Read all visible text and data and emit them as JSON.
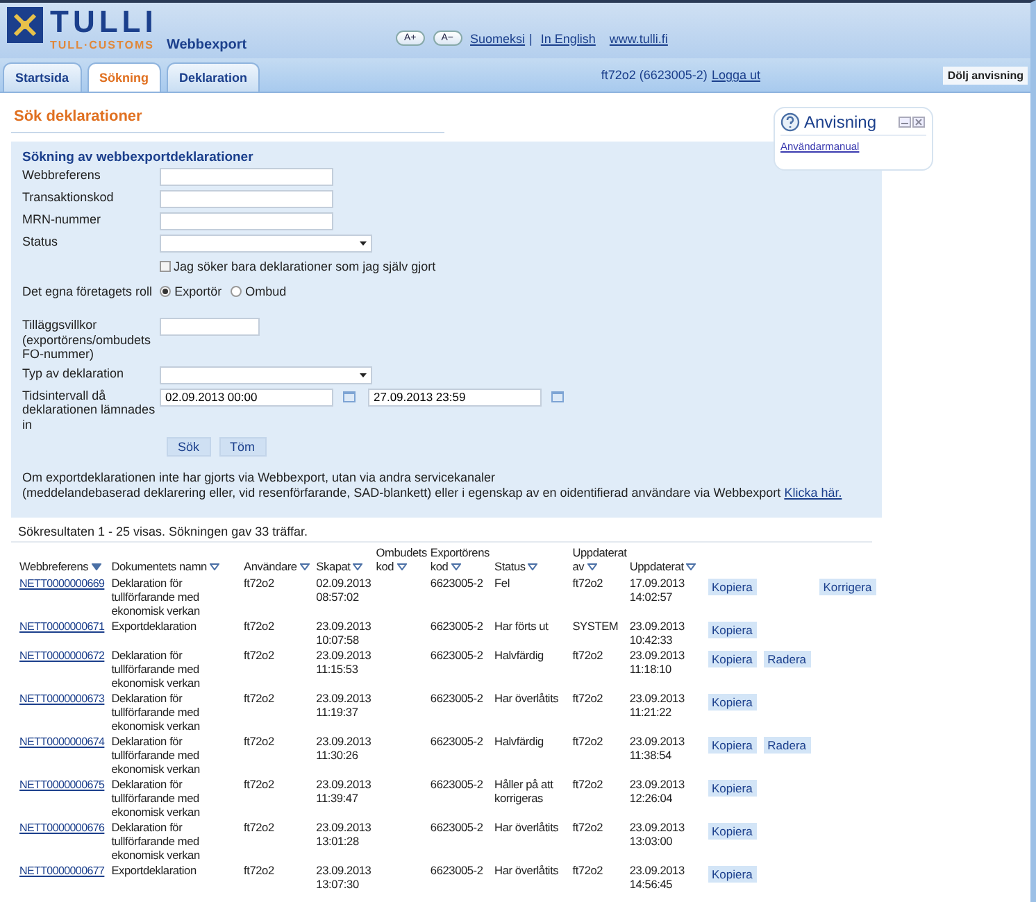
{
  "header": {
    "logo_title": "TULLI",
    "logo_subtitle": "TULL·CUSTOMS",
    "app_name": "Webbexport",
    "font_buttons": [
      "A+",
      "A−"
    ],
    "language_links": [
      {
        "label": "Suomeksi",
        "separator": "|"
      },
      {
        "label": "In English"
      }
    ],
    "site_link": "www.tulli.fi"
  },
  "tabs": [
    {
      "label": "Startsida",
      "selected": false
    },
    {
      "label": "Sökning",
      "selected": true
    },
    {
      "label": "Deklaration",
      "selected": false
    }
  ],
  "user": "ft72o2 (6623005-2)",
  "logout": "Logga ut",
  "hide_help": "Dölj anvisning",
  "page_title": "Sök deklarationer",
  "help_panel": {
    "title": "Anvisning",
    "link": "Användarmanual"
  },
  "form": {
    "title": "Sökning av webbexportdeklarationer",
    "fields": [
      {
        "label": "Webbreferens",
        "kind": "text"
      },
      {
        "label": "Transaktionskod",
        "kind": "text"
      },
      {
        "label": "MRN-nummer",
        "kind": "text"
      },
      {
        "label": "Status",
        "kind": "select"
      }
    ],
    "own_only": {
      "label": "Jag söker bara deklarationer som jag själv gjort",
      "checked": false
    },
    "role": {
      "label": "Det egna företagets roll",
      "options": [
        {
          "label": "Exportör",
          "selected": true
        },
        {
          "label": "Ombud",
          "selected": false
        }
      ]
    },
    "extra_fields": [
      {
        "label": "Tilläggsvillkor (exportörens/ombudets FO-nummer)",
        "kind": "short"
      },
      {
        "label": "Typ av deklaration",
        "kind": "select"
      }
    ],
    "interval": {
      "label": "Tidsintervall då deklarationen lämnades in",
      "from": "02.09.2013 00:00",
      "to": "27.09.2013 23:59"
    },
    "buttons": [
      "Sök",
      "Töm"
    ],
    "info": {
      "line_1": "Om exportdeklarationen inte har gjorts via Webbexport, utan via andra servicekanaler",
      "line_2": "(meddelandebaserad deklarering eller, vid resenförfarande, SAD-blankett) eller i egenskap av en oidentifierad användare via Webbexport",
      "link": "Klicka här."
    }
  },
  "results_summary": "Sökresultaten 1 - 25 visas. Sökningen gav 33 träffar.",
  "table": {
    "columns": [
      {
        "label": "Webbreferens",
        "sorted": true
      },
      {
        "label": "Dokumentets namn",
        "sorted": false
      },
      {
        "label": "Användare",
        "sorted": false
      },
      {
        "label": "Skapat",
        "sorted": false
      },
      {
        "label": "Ombudets kod",
        "sorted": false
      },
      {
        "label": "Exportörens kod",
        "sorted": false
      },
      {
        "label": "Status",
        "sorted": false
      },
      {
        "label": "Uppdaterat av",
        "sorted": false
      },
      {
        "label": "Uppdaterat",
        "sorted": false
      }
    ],
    "rows": [
      {
        "ref": "NETT0000000669",
        "name": "Deklaration för tullförfarande med ekonomisk verkan",
        "user": "ft72o2",
        "created": [
          "02.09.2013",
          "08:57:02"
        ],
        "exporter": "6623005-2",
        "status": "Fel",
        "updated_by": "ft72o2",
        "updated": [
          "17.09.2013",
          "14:02:57"
        ],
        "actions": [
          {
            "kind": "copy",
            "label": "Kopiera"
          },
          {
            "kind": "correct",
            "label": "Korrigera"
          }
        ]
      },
      {
        "ref": "NETT0000000671",
        "name": "Exportdeklaration",
        "user": "ft72o2",
        "created": [
          "23.09.2013",
          "10:07:58"
        ],
        "exporter": "6623005-2",
        "status": "Har förts ut",
        "updated_by": "SYSTEM",
        "updated": [
          "23.09.2013",
          "10:42:33"
        ],
        "actions": [
          {
            "kind": "copy",
            "label": "Kopiera"
          }
        ]
      },
      {
        "ref": "NETT0000000672",
        "name": "Deklaration för tullförfarande med ekonomisk verkan",
        "user": "ft72o2",
        "created": [
          "23.09.2013",
          "11:15:53"
        ],
        "exporter": "6623005-2",
        "status": "Halvfärdig",
        "updated_by": "ft72o2",
        "updated": [
          "23.09.2013",
          "11:18:10"
        ],
        "actions": [
          {
            "kind": "copy",
            "label": "Kopiera"
          },
          {
            "kind": "delete",
            "label": "Radera"
          }
        ]
      },
      {
        "ref": "NETT0000000673",
        "name": "Deklaration för tullförfarande med ekonomisk verkan",
        "user": "ft72o2",
        "created": [
          "23.09.2013",
          "11:19:37"
        ],
        "exporter": "6623005-2",
        "status": "Har överlåtits",
        "updated_by": "ft72o2",
        "updated": [
          "23.09.2013",
          "11:21:22"
        ],
        "actions": [
          {
            "kind": "copy",
            "label": "Kopiera"
          }
        ]
      },
      {
        "ref": "NETT0000000674",
        "name": "Deklaration för tullförfarande med ekonomisk verkan",
        "user": "ft72o2",
        "created": [
          "23.09.2013",
          "11:30:26"
        ],
        "exporter": "6623005-2",
        "status": "Halvfärdig",
        "updated_by": "ft72o2",
        "updated": [
          "23.09.2013",
          "11:38:54"
        ],
        "actions": [
          {
            "kind": "copy",
            "label": "Kopiera"
          },
          {
            "kind": "delete",
            "label": "Radera"
          }
        ]
      },
      {
        "ref": "NETT0000000675",
        "name": "Deklaration för tullförfarande med ekonomisk verkan",
        "user": "ft72o2",
        "created": [
          "23.09.2013",
          "11:39:47"
        ],
        "exporter": "6623005-2",
        "status": "Håller på att korrigeras",
        "updated_by": "ft72o2",
        "updated": [
          "23.09.2013",
          "12:26:04"
        ],
        "actions": [
          {
            "kind": "copy",
            "label": "Kopiera"
          }
        ]
      },
      {
        "ref": "NETT0000000676",
        "name": "Deklaration för tullförfarande med ekonomisk verkan",
        "user": "ft72o2",
        "created": [
          "23.09.2013",
          "13:01:28"
        ],
        "exporter": "6623005-2",
        "status": "Har överlåtits",
        "updated_by": "ft72o2",
        "updated": [
          "23.09.2013",
          "13:03:00"
        ],
        "actions": [
          {
            "kind": "copy",
            "label": "Kopiera"
          }
        ]
      },
      {
        "ref": "NETT0000000677",
        "name": "Exportdeklaration",
        "user": "ft72o2",
        "created": [
          "23.09.2013",
          "13:07:30"
        ],
        "exporter": "6623005-2",
        "status": "Har överlåtits",
        "updated_by": "ft72o2",
        "updated": [
          "23.09.2013",
          "14:56:45"
        ],
        "actions": [
          {
            "kind": "copy",
            "label": "Kopiera"
          }
        ]
      }
    ]
  }
}
